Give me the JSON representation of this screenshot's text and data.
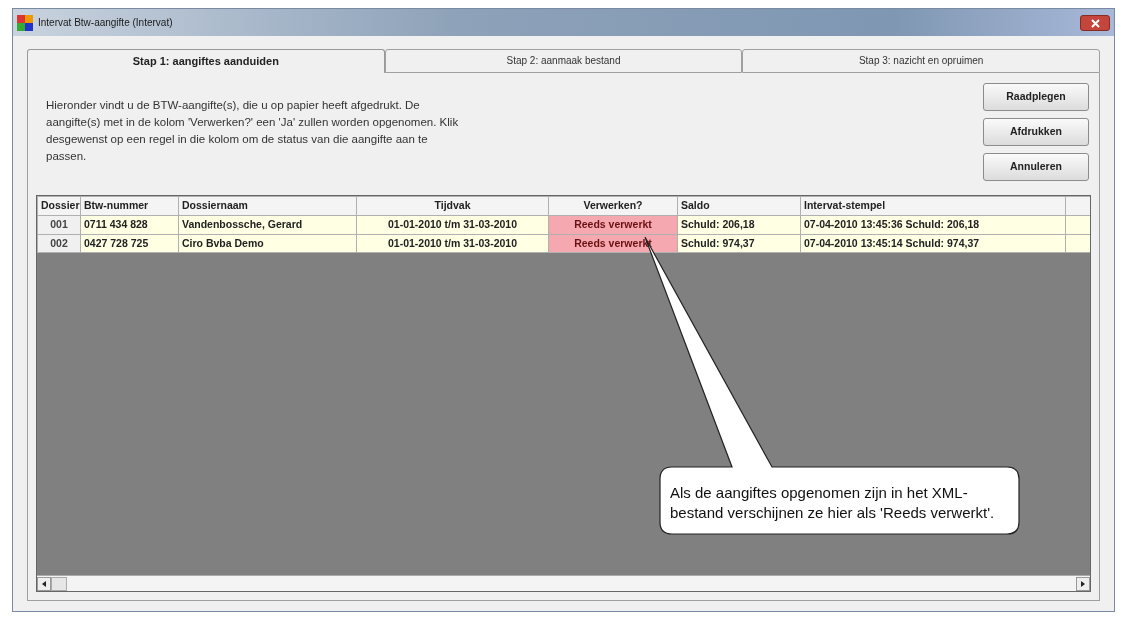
{
  "window": {
    "title": "Intervat Btw-aangifte (Intervat)"
  },
  "tabs": [
    {
      "label": "Stap 1: aangiftes aanduiden",
      "selected": true
    },
    {
      "label": "Stap 2: aanmaak bestand",
      "selected": false
    },
    {
      "label": "Stap 3: nazicht en opruimen",
      "selected": false
    }
  ],
  "intro": "Hieronder vindt u de BTW-aangifte(s), die u op papier heeft afgedrukt. De aangifte(s) met in de kolom 'Verwerken?' een 'Ja' zullen worden opgenomen. Klik desgewenst op een regel in die kolom om de status van die aangifte aan te passen.",
  "buttons": [
    "Raadplegen",
    "Afdrukken",
    "Annuleren"
  ],
  "table": {
    "columns": [
      "Dossier",
      "Btw-nummer",
      "Dossiernaam",
      "Tijdvak",
      "Verwerken?",
      "Saldo",
      "Intervat-stempel"
    ],
    "rows": [
      {
        "cells": [
          "001",
          "0711 434 828",
          "Vandenbossche, Gerard",
          "01-01-2010 t/m 31-03-2010",
          "Reeds verwerkt",
          "Schuld: 206,18",
          "07-04-2010  13:45:36  Schuld: 206,18"
        ]
      },
      {
        "cells": [
          "002",
          "0427 728 725",
          "Ciro Bvba Demo",
          "01-01-2010 t/m 31-03-2010",
          "Reeds verwerkt",
          "Schuld: 974,37",
          "07-04-2010  13:45:14  Schuld: 974,37"
        ]
      }
    ]
  },
  "callout": {
    "text": "Als de aangiftes opgenomen zijn in het XML-bestand verschijnen ze hier als 'Reeds verwerkt'."
  }
}
